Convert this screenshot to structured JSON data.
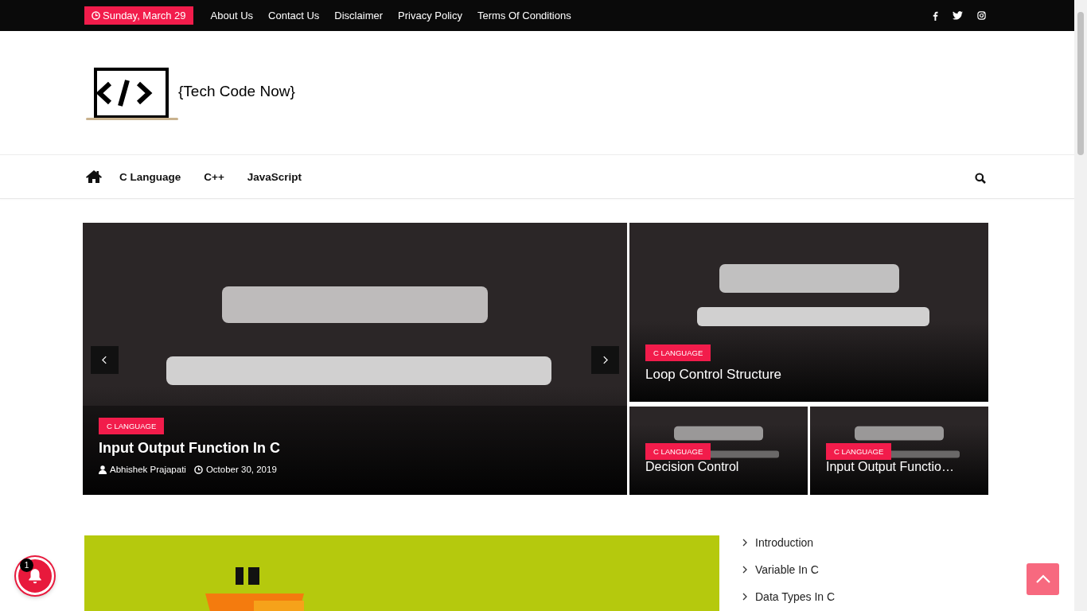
{
  "top_bar": {
    "date": "Sunday, March 29",
    "links": [
      "About Us",
      "Contact Us",
      "Disclaimer",
      "Privacy Policy",
      "Terms Of Conditions"
    ]
  },
  "logo": {
    "text": "{Tech Code Now}"
  },
  "nav": {
    "items": [
      "C Language",
      "C++",
      "JavaScript"
    ]
  },
  "slider": {
    "main": {
      "category": "C LANGUAGE",
      "title": "Input Output Function In C",
      "author": "Abhishek Prajapati",
      "date": "October 30, 2019"
    },
    "side": [
      {
        "category": "C LANGUAGE",
        "title": "Loop Control Structure"
      },
      {
        "category": "C LANGUAGE",
        "title": "Decision Control"
      },
      {
        "category": "C LANGUAGE",
        "title": "Input Output Functio…"
      }
    ]
  },
  "sidebar": {
    "links": [
      "Introduction",
      "Variable In C",
      "Data Types In C"
    ]
  },
  "notification": {
    "count": "1"
  }
}
